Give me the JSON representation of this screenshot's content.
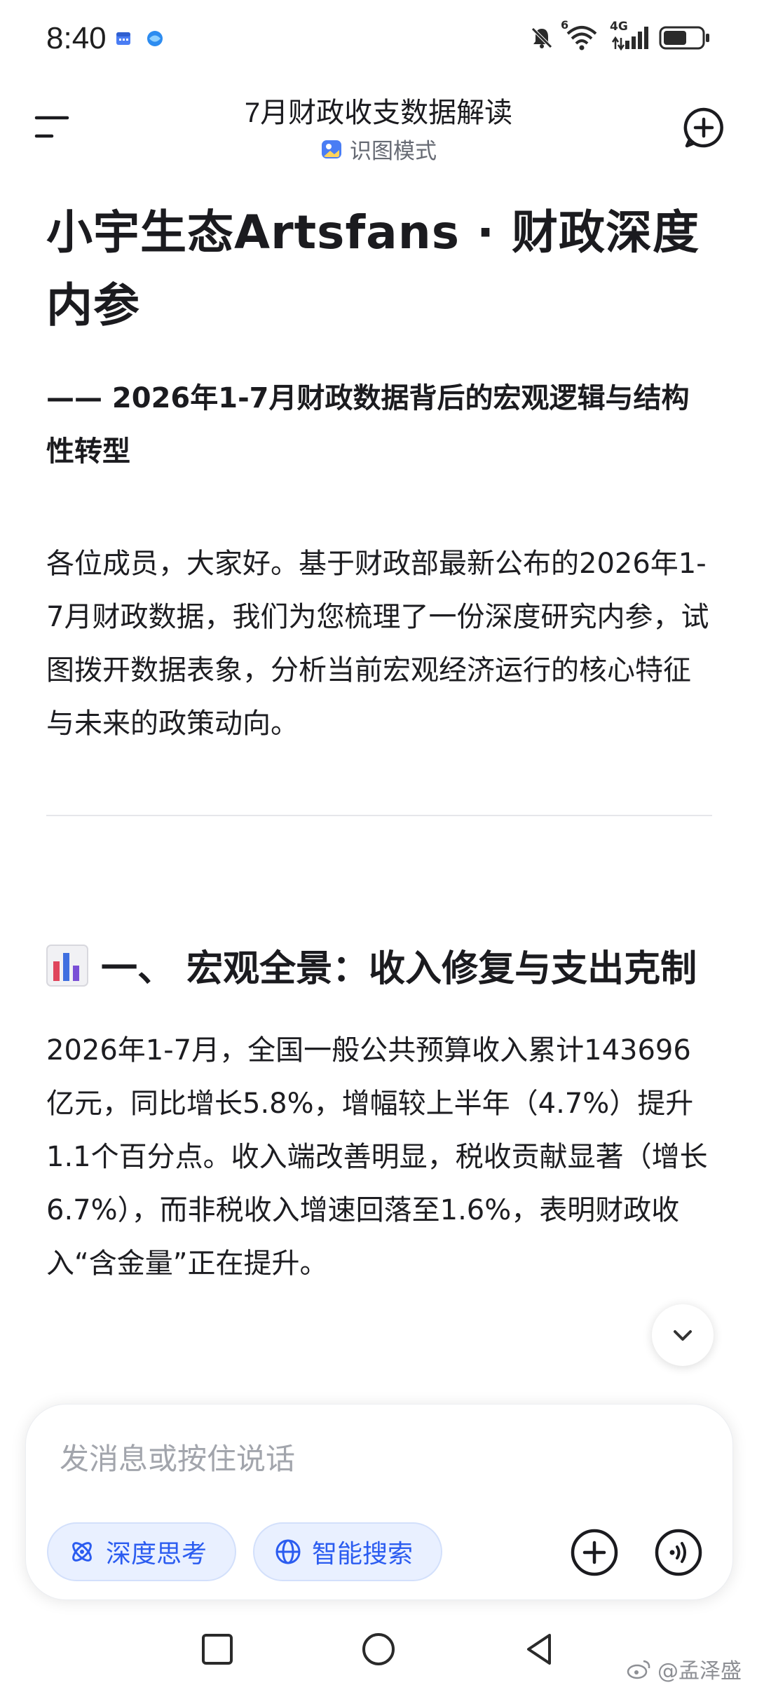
{
  "status_bar": {
    "time": "8:40",
    "icons": [
      "calendar-icon",
      "browser-icon",
      "mute-icon",
      "wifi-icon",
      "signal-icon",
      "battery-icon"
    ],
    "network": "4G",
    "wifi_badge": "6"
  },
  "header": {
    "title": "7月财政收支数据解读",
    "mode": "识图模式",
    "icons": [
      "menu-icon",
      "new-chat-icon"
    ]
  },
  "article": {
    "title": "小宇生态Artsfans · 财政深度内参",
    "subtitle": "—— 2026年1-7月财政数据背后的宏观逻辑与结构性转型",
    "intro": "各位成员，大家好。基于财政部最新公布的2026年1-7月财政数据，我们为您梳理了一份深度研究内参，试图拨开数据表象，分析当前宏观经济运行的核心特征与未来的政策动向。",
    "section1_title": "一、 宏观全景：收入修复与支出克制",
    "section1_icon": "bar-chart-icon",
    "section1_text": "2026年1-7月，全国一般公共预算收入累计143696亿元，同比增长5.8%，增幅较上半年（4.7%）提升1.1个百分点。收入端改善明显，税收贡献显著（增长6.7%），而非税收入增速回落至1.6%，表明财政收入“含金量”正在提升。"
  },
  "composer": {
    "placeholder": "发消息或按住说话",
    "chip_deep": "深度思考",
    "chip_search": "智能搜索"
  },
  "watermark": "@孟泽盛",
  "colors": {
    "accent": "#2b5cf0",
    "chip_bg": "#e9f0ff",
    "text": "#1b1b1f",
    "muted": "#666a73"
  }
}
